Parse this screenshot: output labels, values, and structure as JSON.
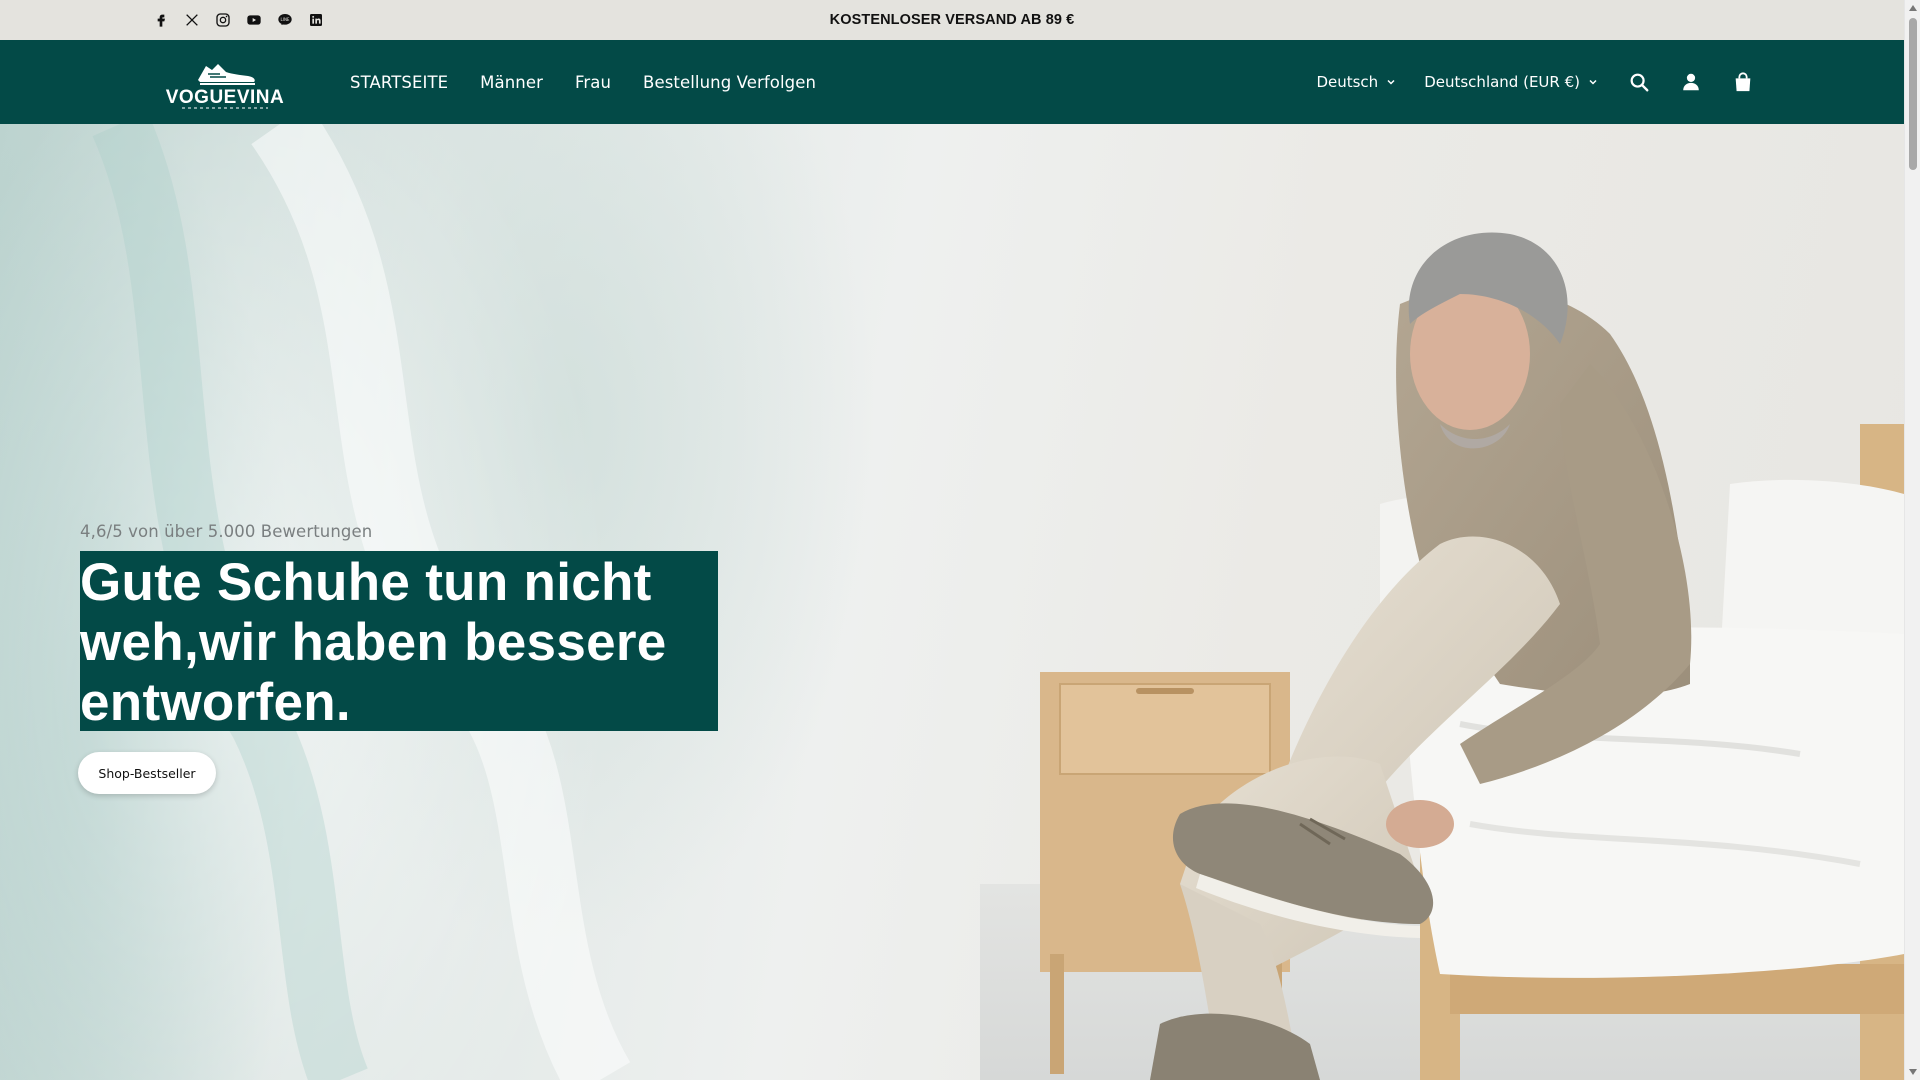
{
  "announcement": {
    "text": "KOSTENLOSER VERSAND AB 89 €",
    "social_icons": [
      "facebook-icon",
      "x-twitter-icon",
      "instagram-icon",
      "youtube-icon",
      "line-icon",
      "linkedin-icon"
    ]
  },
  "header": {
    "logo_text": "VOGUEVINA",
    "nav": [
      {
        "label": "STARTSEITE"
      },
      {
        "label": "Männer"
      },
      {
        "label": "Frau"
      },
      {
        "label": "Bestellung Verfolgen"
      }
    ],
    "language": "Deutsch",
    "country": "Deutschland (EUR €)",
    "icons": [
      "search-icon",
      "account-icon",
      "cart-icon"
    ]
  },
  "hero": {
    "rating": "4,6/5 von über 5.000 Bewertungen",
    "headline_lines": [
      "Gute Schuhe tun nicht",
      "weh,wir haben bessere",
      "entworfen."
    ],
    "cta_label": "Shop-Bestseller"
  },
  "colors": {
    "brand": "#034a47",
    "announcement_bg": "#e4e3de",
    "white": "#ffffff"
  }
}
